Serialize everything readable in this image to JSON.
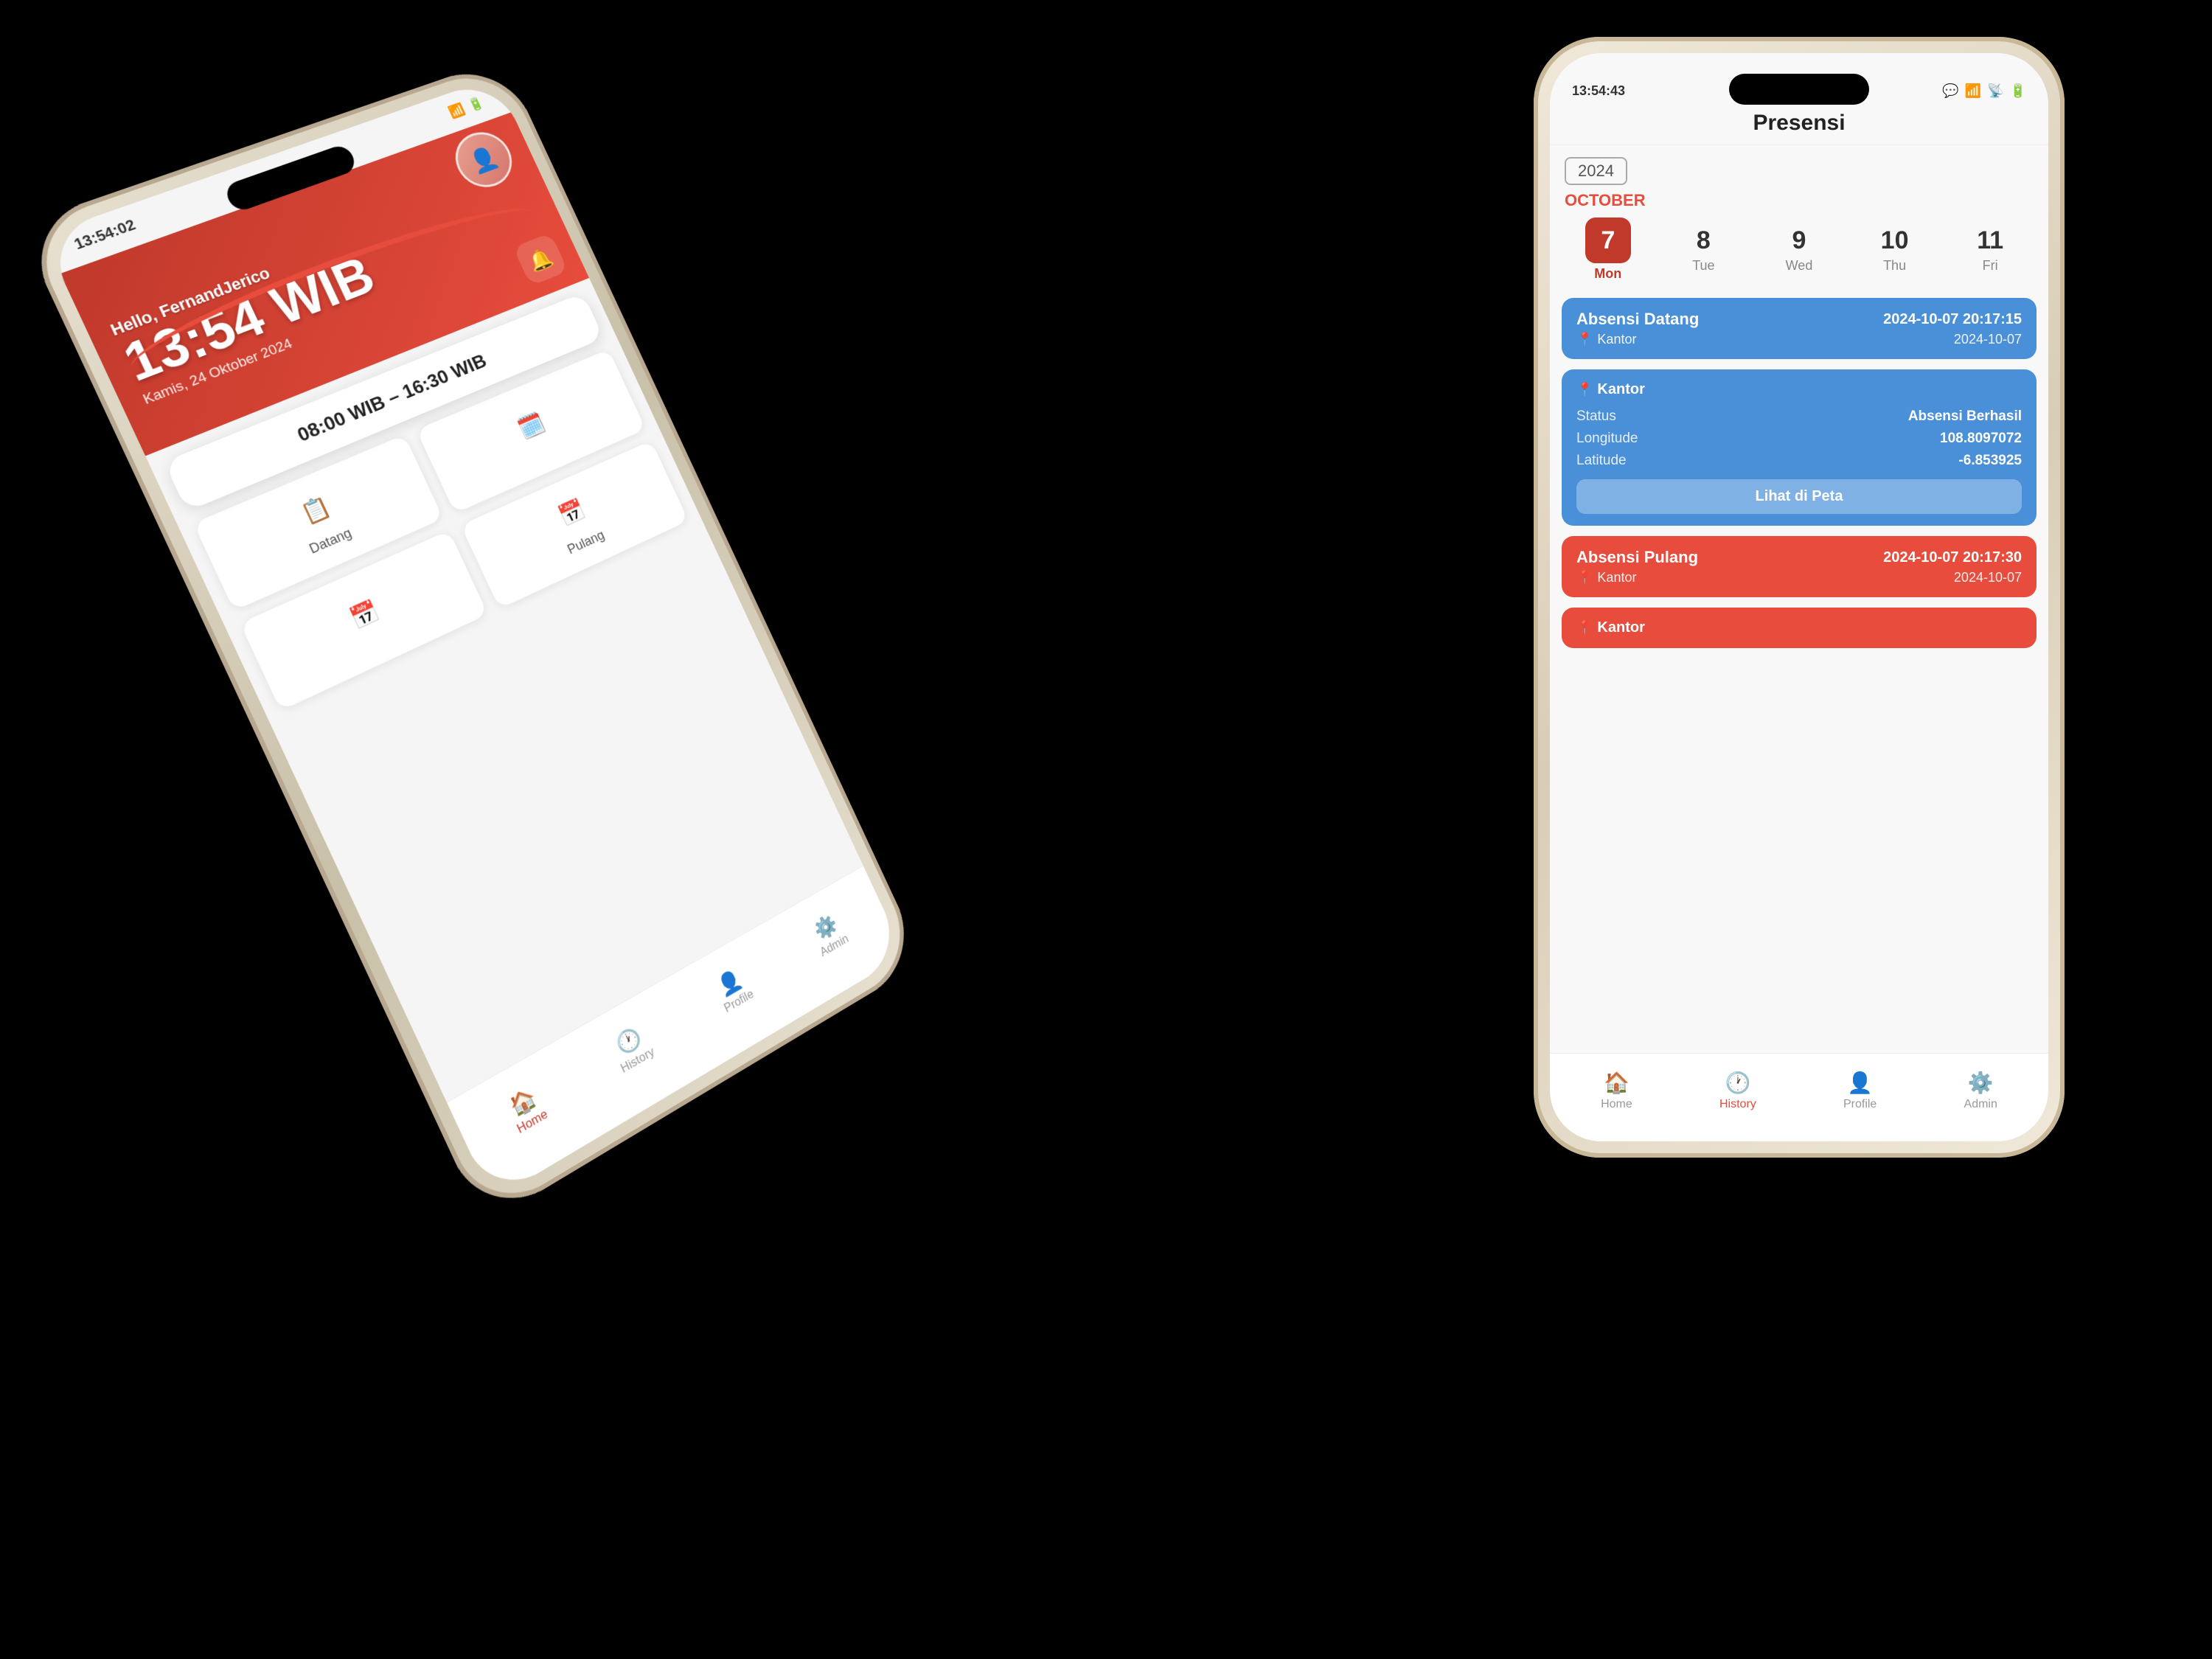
{
  "left_phone": {
    "status_time": "13:54:02",
    "header": {
      "greeting": "Hello, FernandJerico",
      "time": "13:54 WIB",
      "date": "Kamis, 24 Oktober 2024"
    },
    "schedule": {
      "hours": "08:00 WIB – 16:30 WIB"
    },
    "actions": [
      {
        "icon": "📋",
        "label": "Datang"
      },
      {
        "icon": "🗓️",
        "label": ""
      },
      {
        "icon": "📅",
        "label": ""
      },
      {
        "icon": "📅",
        "label": "Pulang"
      }
    ],
    "nav": [
      {
        "icon": "🏠",
        "label": "Home",
        "active": true
      },
      {
        "icon": "🕐",
        "label": "History",
        "active": false
      },
      {
        "icon": "👤",
        "label": "Profile",
        "active": false
      },
      {
        "icon": "⚙️",
        "label": "Admin",
        "active": false
      }
    ]
  },
  "right_phone": {
    "status_time": "13:54:43",
    "title": "Presensi",
    "year": "2024",
    "month": "OCTOBER",
    "days": [
      {
        "num": "7",
        "name": "Mon",
        "active": true
      },
      {
        "num": "8",
        "name": "Tue",
        "active": false
      },
      {
        "num": "9",
        "name": "Wed",
        "active": false
      },
      {
        "num": "10",
        "name": "Thu",
        "active": false
      },
      {
        "num": "11",
        "name": "Fri",
        "active": false
      }
    ],
    "cards": [
      {
        "type": "blue-header",
        "title": "Absensi Datang",
        "time": "2024-10-07 20:17:15",
        "location_label": "Kantor",
        "location_date": "2024-10-07"
      },
      {
        "type": "blue-detail",
        "location": "Kantor",
        "status_label": "Status",
        "status_value": "Absensi Berhasil",
        "longitude_label": "Longitude",
        "longitude_value": "108.8097072",
        "latitude_label": "Latitude",
        "latitude_value": "-6.853925",
        "map_btn": "Lihat di Peta"
      },
      {
        "type": "red-header",
        "title": "Absensi Pulang",
        "time": "2024-10-07 20:17:30",
        "location_label": "Kantor",
        "location_date": "2024-10-07"
      },
      {
        "type": "red-detail",
        "location": "Kantor"
      }
    ],
    "nav": [
      {
        "icon": "🏠",
        "label": "Home",
        "active": false
      },
      {
        "icon": "🕐",
        "label": "History",
        "active": true
      },
      {
        "icon": "👤",
        "label": "Profile",
        "active": false
      },
      {
        "icon": "⚙️",
        "label": "Admin",
        "active": false
      }
    ]
  }
}
